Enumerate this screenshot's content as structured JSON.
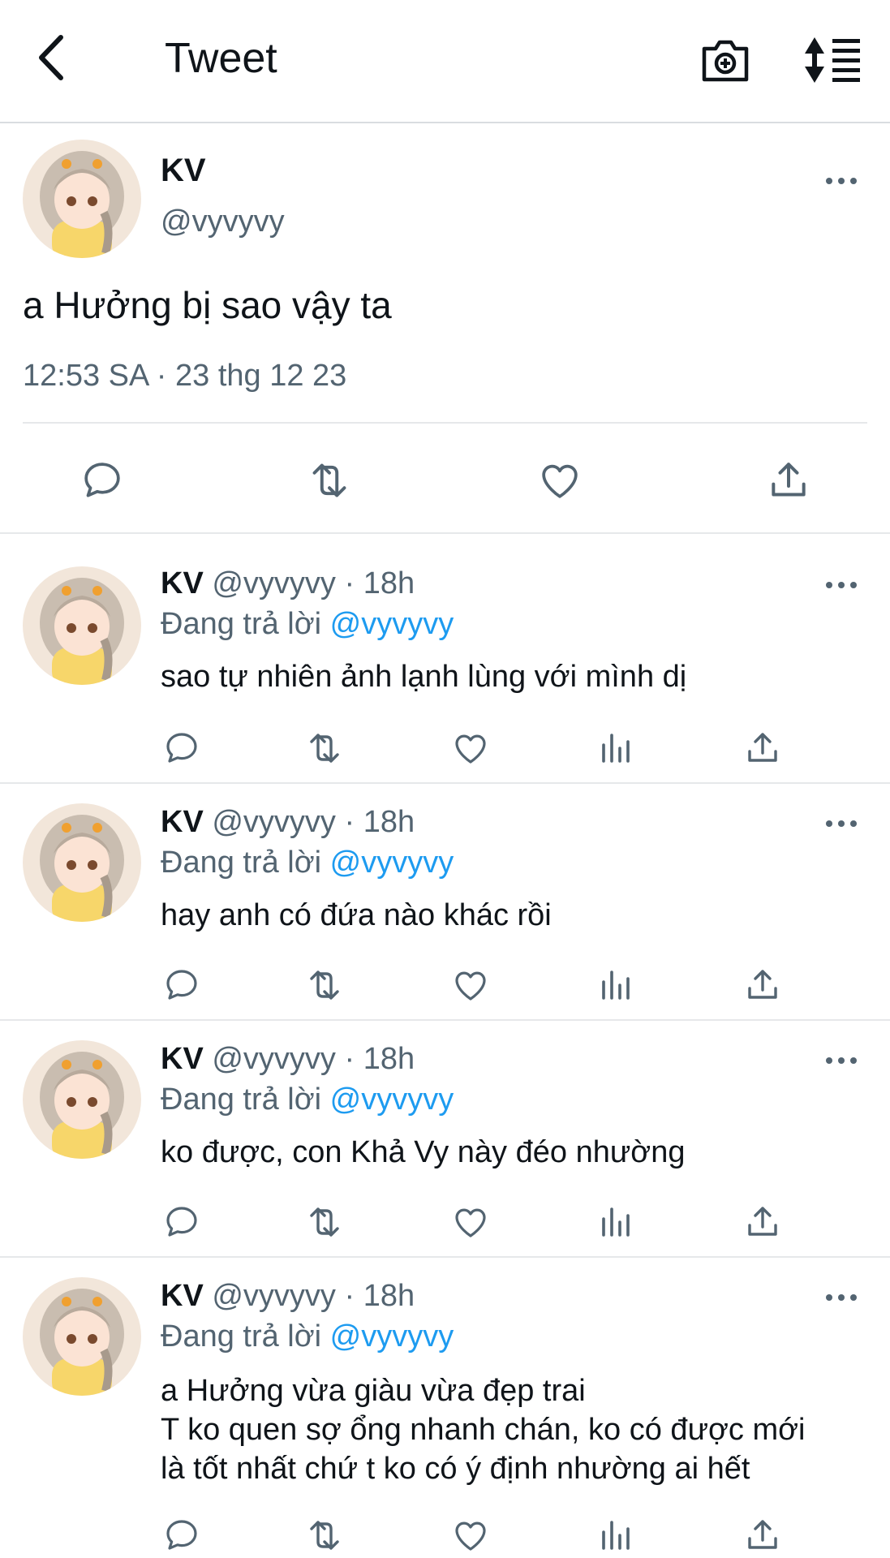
{
  "header": {
    "title": "Tweet"
  },
  "main_tweet": {
    "name": "KV",
    "handle": "@vyvyvy",
    "text": "a Hưởng bị sao vậy ta",
    "timestamp": "12:53 SA · 23 thg 12 23"
  },
  "replies": [
    {
      "name": "KV",
      "handle": "@vyvyvy",
      "time": "· 18h",
      "replying_label": "Đang trả lời",
      "replying_to": "@vyvyvy",
      "lines": [
        "sao tự nhiên ảnh lạnh lùng với mình dị"
      ]
    },
    {
      "name": "KV",
      "handle": "@vyvyvy",
      "time": "· 18h",
      "replying_label": "Đang trả lời",
      "replying_to": "@vyvyvy",
      "lines": [
        "hay anh có đứa nào khác rồi"
      ]
    },
    {
      "name": "KV",
      "handle": "@vyvyvy",
      "time": "· 18h",
      "replying_label": "Đang trả lời",
      "replying_to": "@vyvyvy",
      "lines": [
        "ko được, con Khả Vy này đéo nhường"
      ]
    },
    {
      "name": "KV",
      "handle": "@vyvyvy",
      "time": "· 18h",
      "replying_label": "Đang trả lời",
      "replying_to": "@vyvyvy",
      "lines": [
        "a Hưởng vừa giàu vừa đẹp trai",
        "T ko quen sợ ổng nhanh chán, ko có được mới",
        "là tốt nhất chứ t ko có ý định nhường ai hết"
      ]
    }
  ],
  "colors": {
    "link": "#1d9bf0",
    "muted": "#536471",
    "icon": "#536471"
  }
}
